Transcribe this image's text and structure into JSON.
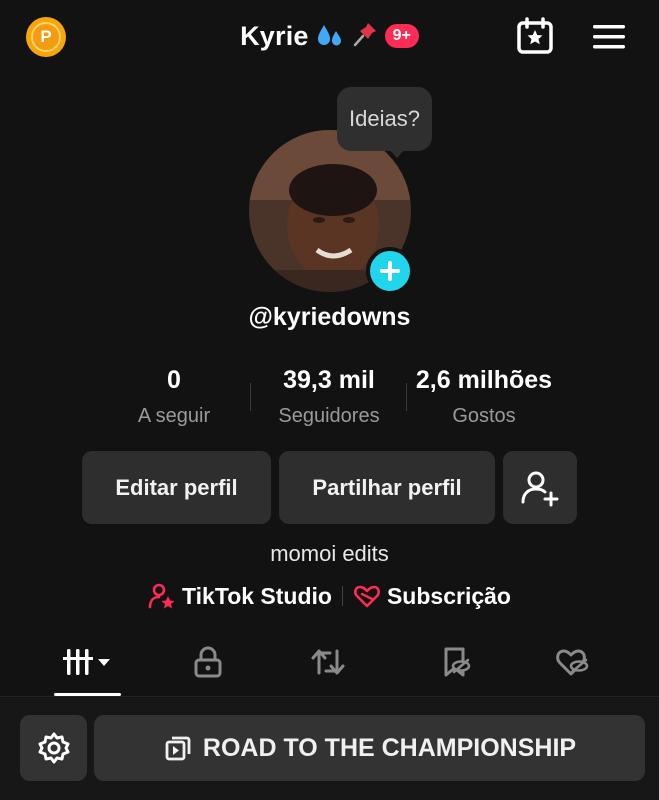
{
  "header": {
    "coin_letter": "P",
    "title": "Kyrie",
    "badge": "9+"
  },
  "profile": {
    "tooltip": "Ideias?",
    "handle": "@kyriedowns",
    "bio": "momoi edits"
  },
  "stats": [
    {
      "value": "0",
      "label": "A seguir"
    },
    {
      "value": "39,3 mil",
      "label": "Seguidores"
    },
    {
      "value": "2,6 milhões",
      "label": "Gostos"
    }
  ],
  "buttons": {
    "edit": "Editar perfil",
    "share": "Partilhar perfil"
  },
  "links": {
    "studio": "TikTok Studio",
    "subscription": "Subscrição"
  },
  "bottom": {
    "playlist": "ROAD TO THE CHAMPIONSHIP"
  },
  "colors": {
    "accent": "#fe2c55",
    "avatar_plus": "#20d5ec",
    "coin": "#f6a609",
    "background": "#121212"
  }
}
